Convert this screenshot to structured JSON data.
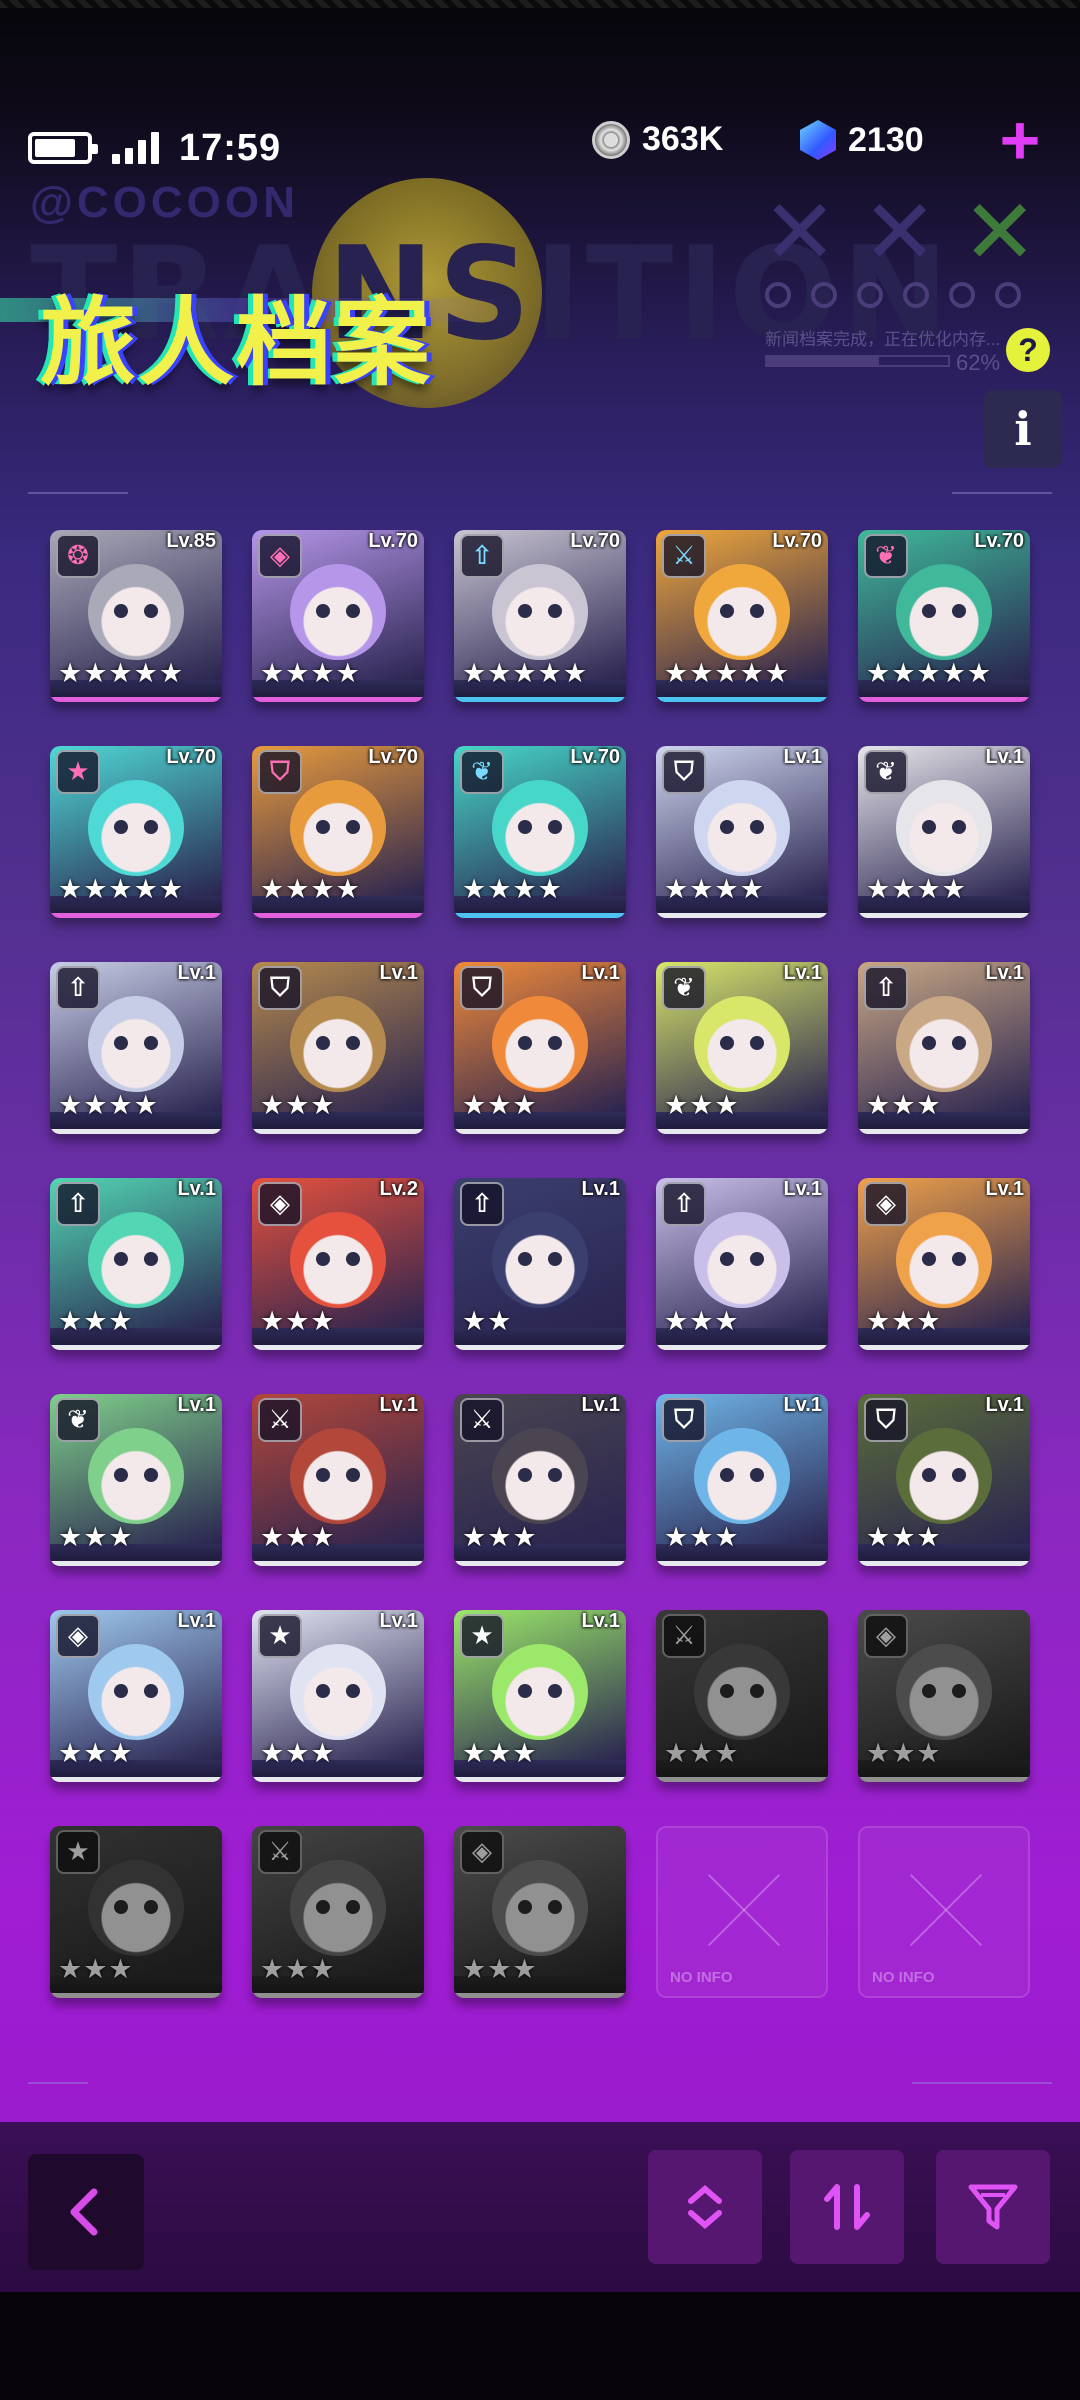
{
  "status_bar": {
    "time": "17:59"
  },
  "currency": {
    "coins": "363K",
    "gems": "2130"
  },
  "header": {
    "title": "旅人档案",
    "bg_brand": "@COCOON",
    "bg_word": "TRANSITION",
    "sync_text": "新闻档案完成，正在优化内存...",
    "progress_percent": "62%",
    "progress_value": 0.62,
    "help_label": "?",
    "info_label": "i"
  },
  "empty_label": "NO INFO",
  "characters": [
    {
      "level": "Lv.85",
      "stars": "★★★★★",
      "role_icon": "spiral-icon",
      "rarity": "pink",
      "color": "#a9a9b8",
      "state": "owned"
    },
    {
      "level": "Lv.70",
      "stars": "★★★★",
      "role_icon": "diamond-icon",
      "rarity": "pink",
      "color": "#b596e8",
      "state": "owned"
    },
    {
      "level": "Lv.70",
      "stars": "★★★★★",
      "role_icon": "arrow-up-icon",
      "rarity": "blue",
      "color": "#c9c5d2",
      "state": "owned"
    },
    {
      "level": "Lv.70",
      "stars": "★★★★★",
      "role_icon": "swords-icon",
      "rarity": "blue",
      "color": "#f0a83c",
      "state": "owned"
    },
    {
      "level": "Lv.70",
      "stars": "★★★★★",
      "role_icon": "leaf-icon",
      "rarity": "pink",
      "color": "#3fb99a",
      "state": "owned"
    },
    {
      "level": "Lv.70",
      "stars": "★★★★★",
      "role_icon": "star-icon",
      "rarity": "pink",
      "color": "#4fd9d6",
      "state": "owned"
    },
    {
      "level": "Lv.70",
      "stars": "★★★★",
      "role_icon": "shield-icon",
      "rarity": "pink",
      "color": "#e89b3d",
      "state": "owned"
    },
    {
      "level": "Lv.70",
      "stars": "★★★★",
      "role_icon": "leaf-icon",
      "rarity": "blue",
      "color": "#47d7c8",
      "state": "owned"
    },
    {
      "level": "Lv.1",
      "stars": "★★★★",
      "role_icon": "shield-icon",
      "rarity": "white",
      "color": "#cfd6ef",
      "state": "owned"
    },
    {
      "level": "Lv.1",
      "stars": "★★★★",
      "role_icon": "leaf-icon",
      "rarity": "white",
      "color": "#e6e6ea",
      "state": "owned"
    },
    {
      "level": "Lv.1",
      "stars": "★★★★",
      "role_icon": "arrow-up-icon",
      "rarity": "white",
      "color": "#c7cde6",
      "state": "owned"
    },
    {
      "level": "Lv.1",
      "stars": "★★★",
      "role_icon": "shield-icon",
      "rarity": "white",
      "color": "#b58a4e",
      "state": "owned"
    },
    {
      "level": "Lv.1",
      "stars": "★★★",
      "role_icon": "shield-icon",
      "rarity": "white",
      "color": "#f08a3a",
      "state": "owned"
    },
    {
      "level": "Lv.1",
      "stars": "★★★",
      "role_icon": "leaf-icon",
      "rarity": "white",
      "color": "#d8e66a",
      "state": "owned"
    },
    {
      "level": "Lv.1",
      "stars": "★★★",
      "role_icon": "arrow-up-icon",
      "rarity": "white",
      "color": "#c9a885",
      "state": "owned"
    },
    {
      "level": "Lv.1",
      "stars": "★★★",
      "role_icon": "arrow-up-icon",
      "rarity": "white",
      "color": "#52d6b3",
      "state": "owned"
    },
    {
      "level": "Lv.2",
      "stars": "★★★",
      "role_icon": "diamond-icon",
      "rarity": "white",
      "color": "#e5513d",
      "state": "owned"
    },
    {
      "level": "Lv.1",
      "stars": "★★",
      "role_icon": "arrow-up-icon",
      "rarity": "white",
      "color": "#3b3f6e",
      "state": "owned"
    },
    {
      "level": "Lv.1",
      "stars": "★★★",
      "role_icon": "arrow-up-icon",
      "rarity": "white",
      "color": "#c9c0ea",
      "state": "owned"
    },
    {
      "level": "Lv.1",
      "stars": "★★★",
      "role_icon": "diamond-icon",
      "rarity": "white",
      "color": "#f0a24a",
      "state": "owned"
    },
    {
      "level": "Lv.1",
      "stars": "★★★",
      "role_icon": "leaf-icon",
      "rarity": "white",
      "color": "#7fd08a",
      "state": "owned"
    },
    {
      "level": "Lv.1",
      "stars": "★★★",
      "role_icon": "swords-icon",
      "rarity": "white",
      "color": "#b3473a",
      "state": "owned"
    },
    {
      "level": "Lv.1",
      "stars": "★★★",
      "role_icon": "swords-icon",
      "rarity": "white",
      "color": "#4a4550",
      "state": "owned"
    },
    {
      "level": "Lv.1",
      "stars": "★★★",
      "role_icon": "shield-icon",
      "rarity": "white",
      "color": "#6fb6e8",
      "state": "owned"
    },
    {
      "level": "Lv.1",
      "stars": "★★★",
      "role_icon": "shield-icon",
      "rarity": "white",
      "color": "#5b6d3a",
      "state": "owned"
    },
    {
      "level": "Lv.1",
      "stars": "★★★",
      "role_icon": "diamond-icon",
      "rarity": "white",
      "color": "#9fc9ef",
      "state": "owned"
    },
    {
      "level": "Lv.1",
      "stars": "★★★",
      "role_icon": "star-icon",
      "rarity": "white",
      "color": "#e0e4f2",
      "state": "owned"
    },
    {
      "level": "Lv.1",
      "stars": "★★★",
      "role_icon": "star-icon",
      "rarity": "white",
      "color": "#9be86a",
      "state": "owned"
    },
    {
      "level": "",
      "stars": "★★★",
      "role_icon": "swords-icon",
      "rarity": "white",
      "color": "#5a5a5a",
      "state": "locked"
    },
    {
      "level": "",
      "stars": "★★★",
      "role_icon": "diamond-icon",
      "rarity": "white",
      "color": "#7a7a7a",
      "state": "locked"
    },
    {
      "level": "",
      "stars": "★★★",
      "role_icon": "star-icon",
      "rarity": "white",
      "color": "#505050",
      "state": "locked"
    },
    {
      "level": "",
      "stars": "★★★",
      "role_icon": "swords-icon",
      "rarity": "white",
      "color": "#6d6d6d",
      "state": "locked"
    },
    {
      "level": "",
      "stars": "★★★",
      "role_icon": "diamond-icon",
      "rarity": "white",
      "color": "#7a7a7a",
      "state": "locked"
    },
    {
      "level": "",
      "stars": "",
      "role_icon": "",
      "rarity": "",
      "color": "",
      "state": "empty"
    },
    {
      "level": "",
      "stars": "",
      "role_icon": "",
      "rarity": "",
      "color": "",
      "state": "empty"
    }
  ],
  "toolbar": {
    "buttons": [
      "back-icon",
      "expand-collapse-icon",
      "sort-order-icon",
      "filter-icon"
    ]
  },
  "colors": {
    "accent": "#e23df6",
    "title": "#f2f04b",
    "help": "#e4f23b"
  }
}
